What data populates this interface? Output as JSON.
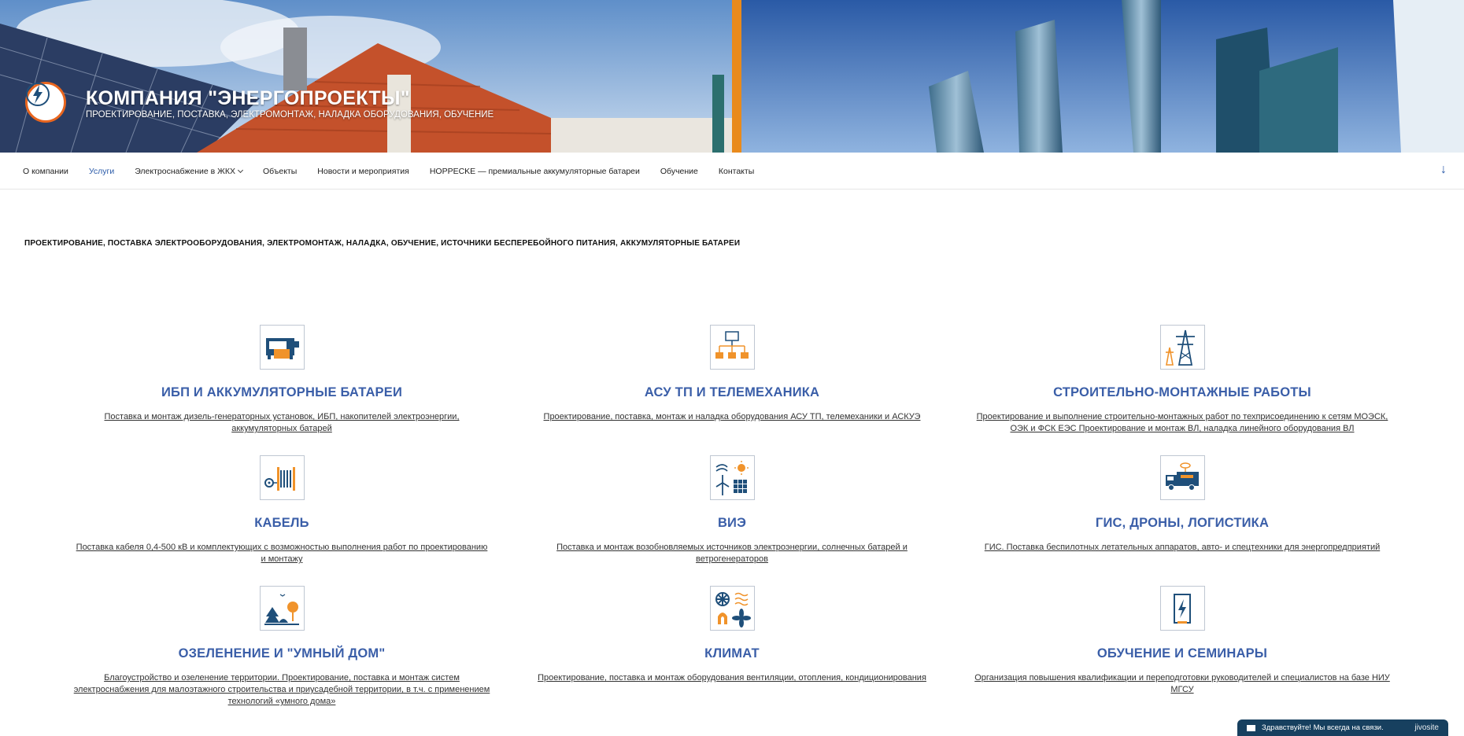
{
  "header": {
    "title": "КОМПАНИЯ \"ЭНЕРГОПРОЕКТЫ\"",
    "tagline": "ПРОЕКТИРОВАНИЕ, ПОСТАВКА, ЭЛЕКТРОМОНТАЖ, НАЛАДКА ОБОРУДОВАНИЯ, ОБУЧЕНИЕ"
  },
  "nav": {
    "items": [
      {
        "label": "О компании"
      },
      {
        "label": "Услуги"
      },
      {
        "label": "Электроснабжение в ЖКХ"
      },
      {
        "label": "Объекты"
      },
      {
        "label": "Новости и мероприятия"
      },
      {
        "label": "HOPPECKE — премиальные аккумуляторные батареи"
      },
      {
        "label": "Обучение"
      },
      {
        "label": "Контакты"
      }
    ],
    "active_index": 1,
    "scroll_icon": "↓"
  },
  "main": {
    "heading": "ПРОЕКТИРОВАНИЕ, ПОСТАВКА ЭЛЕКТРООБОРУДОВАНИЯ, ЭЛЕКТРОМОНТАЖ, НАЛАДКА, ОБУЧЕНИЕ, ИСТОЧНИКИ БЕСПЕРЕБОЙНОГО ПИТАНИЯ, АККУМУЛЯТОРНЫЕ БАТАРЕИ",
    "services": [
      {
        "title": "ИБП И АККУМУЛЯТОРНЫЕ БАТАРЕИ",
        "desc": "Поставка и монтаж дизель-генераторных установок, ИБП, накопителей электроэнергии, аккумуляторных батарей",
        "icon": "generator-icon"
      },
      {
        "title": "АСУ ТП И ТЕЛЕМЕХАНИКА",
        "desc": "Проектирование, поставка, монтаж и наладка оборудования АСУ ТП, телемеханики и АСКУЭ",
        "icon": "network-icon"
      },
      {
        "title": "СТРОИТЕЛЬНО-МОНТАЖНЫЕ РАБОТЫ",
        "desc": "Проектирование и выполнение строительно-монтажных работ по техприсоединению к сетям МОЭСК, ОЭК и ФСК ЕЭС Проектирование и монтаж ВЛ, наладка линейного оборудования ВЛ",
        "icon": "power-tower-icon"
      },
      {
        "title": "КАБЕЛЬ",
        "desc": "Поставка кабеля 0,4-500 кВ и комплектующих с возможностью выполнения работ по проектированию и монтажу",
        "icon": "cable-drum-icon"
      },
      {
        "title": "ВИЭ",
        "desc": "Поставка и монтаж возобновляемых источников электроэнергии, солнечных батарей и ветрогенераторов",
        "icon": "renewable-icon"
      },
      {
        "title": "ГИС, ДРОНЫ, ЛОГИСТИКА",
        "desc": "ГИС. Поставка беспилотных летательных аппаратов, авто- и спецтехники для энергопредприятий",
        "icon": "truck-drone-icon"
      },
      {
        "title": "ОЗЕЛЕНЕНИЕ И \"УМНЫЙ ДОМ\"",
        "desc": "Благоустройство и озеленение территории. Проектирование, поставка и монтаж систем электроснабжения для малоэтажного строительства и приусадебной территории, в т.ч. с применением технологий «умного дома»",
        "icon": "landscape-icon"
      },
      {
        "title": "КЛИМАТ",
        "desc": "Проектирование, поставка и монтаж оборудования вентиляции, отопления, кондиционирования",
        "icon": "climate-icon"
      },
      {
        "title": "ОБУЧЕНИЕ И СЕМИНАРЫ",
        "desc": "Организация повышения квалификации и переподготовки руководителей и специалистов на базе НИУ МГСУ",
        "icon": "training-icon"
      }
    ]
  },
  "chat": {
    "text": "Здравствуйте! Мы всегда на связи.",
    "brand": "jivosite"
  },
  "colors": {
    "accent": "#3a5ea8",
    "orange": "#e9661f",
    "navy": "#17405f"
  }
}
